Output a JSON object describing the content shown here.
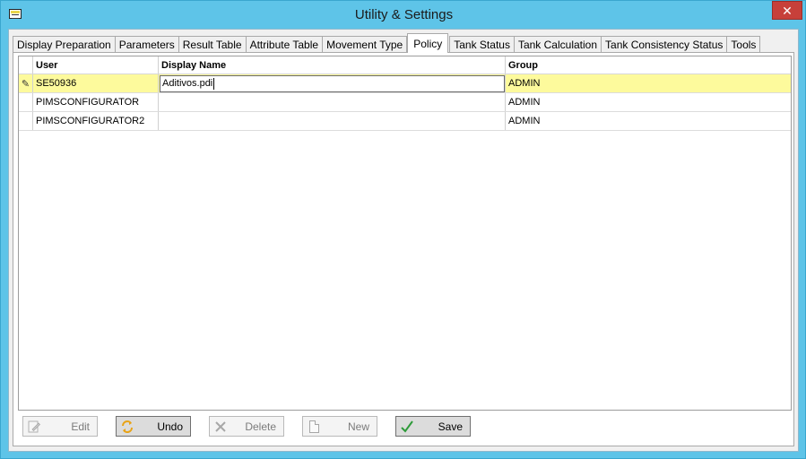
{
  "window": {
    "title": "Utility & Settings",
    "close_symbol": "✕",
    "icon": "app-window-icon"
  },
  "tabs": [
    {
      "label": "Display Preparation",
      "active": false
    },
    {
      "label": "Parameters",
      "active": false
    },
    {
      "label": "Result Table",
      "active": false
    },
    {
      "label": "Attribute Table",
      "active": false
    },
    {
      "label": "Movement Type",
      "active": false
    },
    {
      "label": "Policy",
      "active": true
    },
    {
      "label": "Tank Status",
      "active": false
    },
    {
      "label": "Tank Calculation",
      "active": false
    },
    {
      "label": "Tank Consistency Status",
      "active": false
    },
    {
      "label": "Tools",
      "active": false
    }
  ],
  "grid": {
    "columns": {
      "user": "User",
      "display_name": "Display Name",
      "group": "Group"
    },
    "rows": [
      {
        "user": "SE50936",
        "display_name": "Aditivos.pdi",
        "group": "ADMIN",
        "editing": true
      },
      {
        "user": "PIMSCONFIGURATOR",
        "display_name": "",
        "group": "ADMIN",
        "editing": false
      },
      {
        "user": "PIMSCONFIGURATOR2",
        "display_name": "",
        "group": "ADMIN",
        "editing": false
      }
    ],
    "edit_row_icon": "pencil-icon"
  },
  "toolbar": {
    "edit_label": "Edit",
    "undo_label": "Undo",
    "delete_label": "Delete",
    "new_label": "New",
    "save_label": "Save"
  },
  "colors": {
    "titlebar": "#5ec4e8",
    "close_button": "#c7403a",
    "selected_row": "#fdfa9c",
    "undo_icon": "#e8a317",
    "save_icon": "#2e9b3a"
  }
}
